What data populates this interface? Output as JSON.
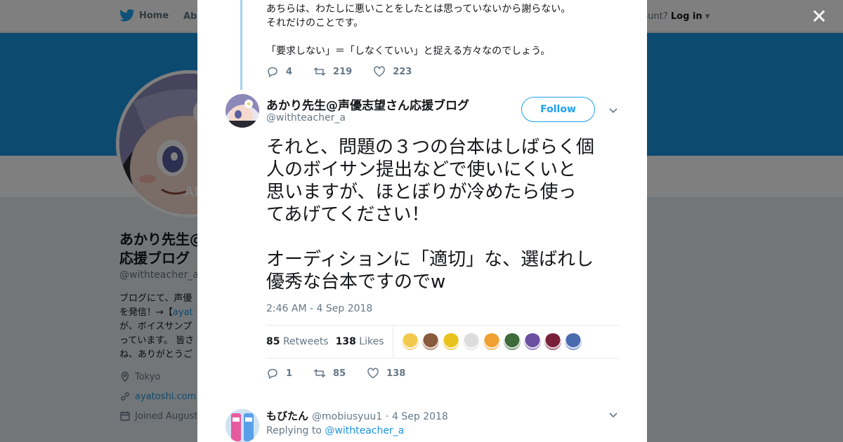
{
  "nav": {
    "home_label": "Home",
    "about_label": "Abo",
    "account_prefix": "ccount?",
    "login_label": "Log in"
  },
  "profile": {
    "avatar_text": "AI",
    "name": "あかり先生@声優志望さん応援ブログ",
    "name_visible": "あかり先生@ 応援ブログ",
    "handle": "@withteacher_a",
    "bio_lines": [
      "ブログにて、声優",
      "を発信！→【",
      "が、ボイスサンプ",
      "っています。 皆さ",
      "ね、ありがとうご"
    ],
    "bio_link": "ayat",
    "location": "Tokyo",
    "website": "ayatoshi.com",
    "joined": "Joined August"
  },
  "previous_tweet": {
    "lines": [
      "あちらは、わたしに悪いことをしたとは思っていないから謝らない。",
      "それだけのことです。",
      "",
      "「要求しない」＝「しなくていい」と捉える方々なのでしょう。"
    ],
    "replies": "4",
    "retweets": "219",
    "likes": "223"
  },
  "tweet": {
    "author_name": "あかり先生@声優志望さん応援ブログ",
    "author_handle": "@withteacher_a",
    "follow_label": "Follow",
    "text_lines": [
      "それと、問題の３つの台本はしばらく個",
      "人のボイサン提出などで使いにくいと",
      "思いますが、ほとぼりが冷めたら使っ",
      "てあげてください！",
      "",
      "オーディションに「適切」な、選ばれし",
      "優秀な台本ですのでw"
    ],
    "timestamp": "2:46 AM - 4 Sep 2018",
    "retweet_count": "85",
    "retweet_label": "Retweets",
    "like_count": "138",
    "like_label": "Likes",
    "replies": "1",
    "retweets": "85",
    "likes": "138",
    "liker_colors": [
      "#f2c94c",
      "#8a5a3c",
      "#e8c21a",
      "#dcdcdc",
      "#f0a030",
      "#3d6b3a",
      "#6a4fa0",
      "#7a1f3a",
      "#4a6ab0"
    ]
  },
  "reply": {
    "name": "もびたん",
    "handle": "@mobiusyuu1",
    "date": "· 4 Sep 2018",
    "replying_prefix": "Replying to",
    "replying_to": "@withteacher_a"
  },
  "colors": {
    "brand": "#1da1f2",
    "banner": "#1b95e0",
    "thread_line": "#a3d2f0"
  }
}
